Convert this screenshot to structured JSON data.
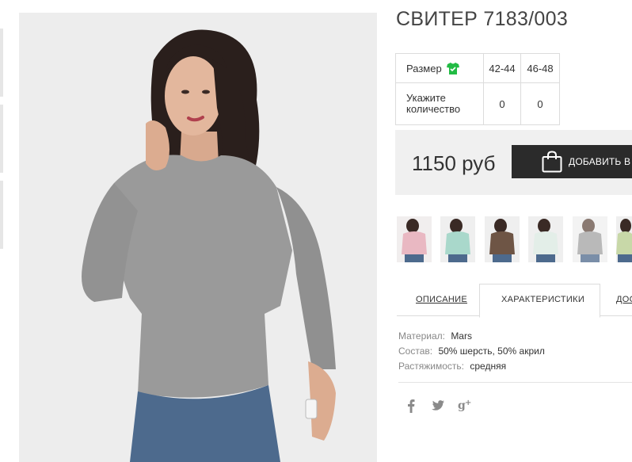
{
  "product": {
    "title": "СВИТЕР 7183/003",
    "price": "1150 руб",
    "add_to_cart_label": "ДОБАВИТЬ В З"
  },
  "size_table": {
    "size_label": "Размер",
    "qty_label": "Укажите количество",
    "sizes": [
      {
        "size": "42-44",
        "qty": "0"
      },
      {
        "size": "46-48",
        "qty": "0"
      }
    ]
  },
  "color_thumbnails": [
    {
      "icon": "pink-sweater-thumbnail"
    },
    {
      "icon": "mint-sweater-thumbnail"
    },
    {
      "icon": "brown-sweater-thumbnail"
    },
    {
      "icon": "white-sweater-thumbnail"
    },
    {
      "icon": "grey-sweater-thumbnail"
    },
    {
      "icon": "green-sweater-thumbnail"
    }
  ],
  "tabs": [
    {
      "label": "ОПИСАНИЕ",
      "active": false
    },
    {
      "label": "ХАРАКТЕРИСТИКИ",
      "active": true
    },
    {
      "label": "ДОС",
      "active": false
    }
  ],
  "specs": [
    {
      "key": "Материал:",
      "value": "Mars"
    },
    {
      "key": "Состав:",
      "value": "50% шерсть, 50% акрил"
    },
    {
      "key": "Растяжимость:",
      "value": "средняя"
    }
  ],
  "social": [
    "facebook-icon",
    "twitter-icon",
    "google-plus-icon"
  ],
  "colors": {
    "accent_green": "#22bb44",
    "button_dark": "#2b2b2b",
    "price_box_bg": "#f0f0f0"
  }
}
